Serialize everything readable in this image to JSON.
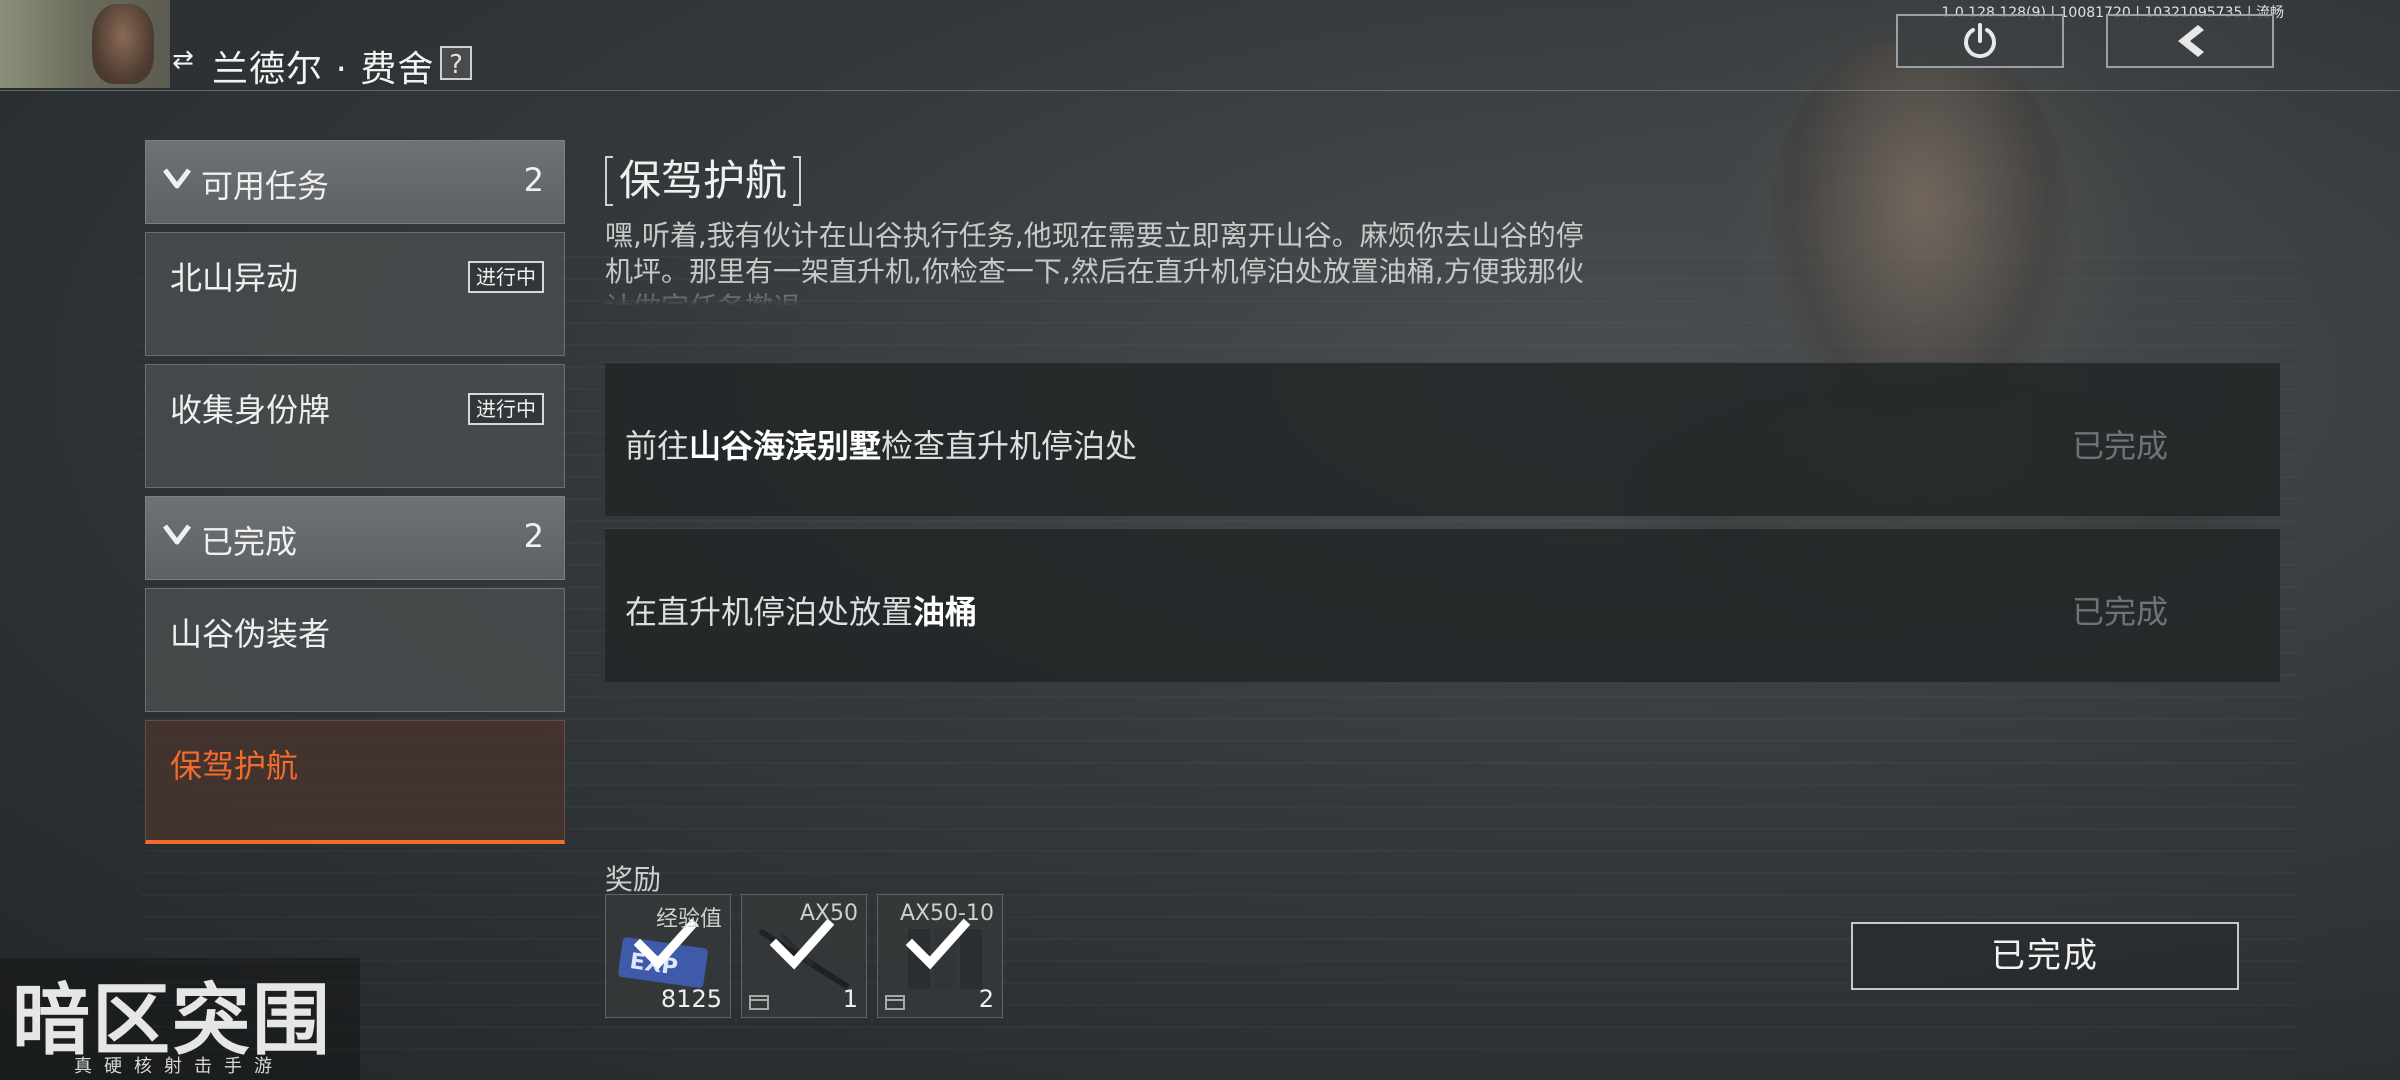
{
  "header": {
    "npc_name": "兰德尔 · 费舍",
    "help_label": "?",
    "version_text": "1.0.128.128(9) | 10081720 | 10321095735 | 流畅"
  },
  "sidebar": {
    "groups": [
      {
        "label": "可用任务",
        "count": "2",
        "items": [
          {
            "label": "北山异动",
            "status": "进行中"
          },
          {
            "label": "收集身份牌",
            "status": "进行中"
          }
        ]
      },
      {
        "label": "已完成",
        "count": "2",
        "items": [
          {
            "label": "山谷伪装者"
          },
          {
            "label": "保驾护航"
          }
        ]
      }
    ]
  },
  "quest": {
    "title": "保驾护航",
    "description": "嘿,听着,我有伙计在山谷执行任务,他现在需要立即离开山谷。麻烦你去山谷的停机坪。那里有一架直升机,你检查一下,然后在直升机停泊处放置油桶,方便我那伙计做完任务撤退。",
    "objectives": [
      {
        "prefix": "前往",
        "highlight": "山谷海滨别墅",
        "suffix": "检查直升机停泊处",
        "state": "已完成"
      },
      {
        "prefix": "在直升机停泊处放置",
        "highlight": "油桶",
        "suffix": "",
        "state": "已完成"
      }
    ]
  },
  "rewards": {
    "label": "奖励",
    "items": [
      {
        "name": "经验值",
        "qty": "8125",
        "icon": "exp-icon"
      },
      {
        "name": "AX50",
        "qty": "1",
        "icon": "rifle-icon"
      },
      {
        "name": "AX50-10",
        "qty": "2",
        "icon": "magazine-icon"
      }
    ]
  },
  "complete_button": "已完成",
  "logo": {
    "title": "暗区突围",
    "tagline": "真硬核射击手游"
  },
  "colors": {
    "accent": "#f26b2d",
    "background": "#34393b",
    "completed_text": "#6e7375"
  }
}
